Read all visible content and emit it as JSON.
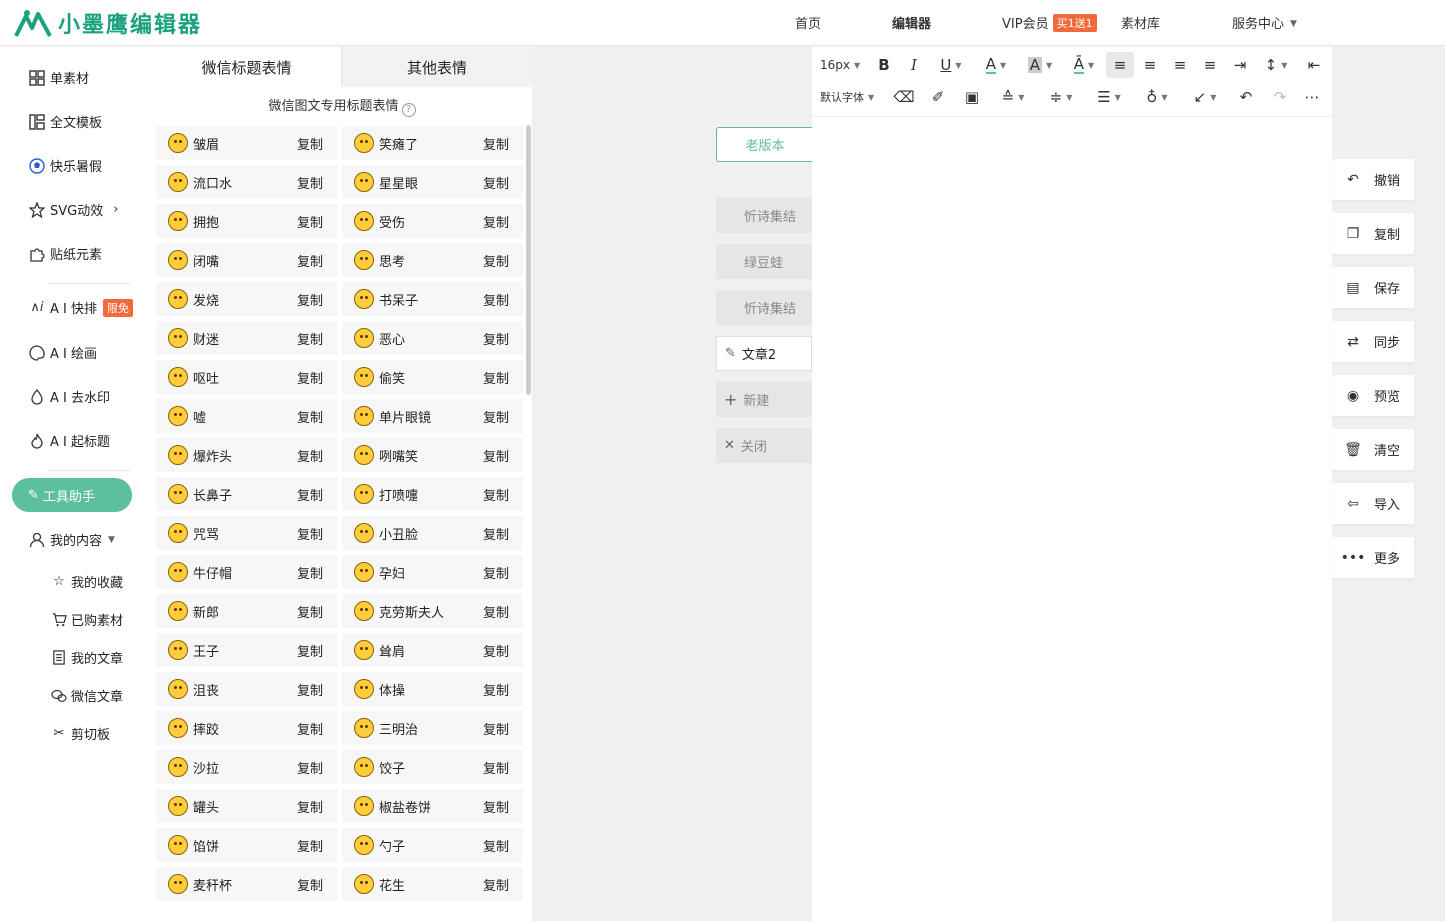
{
  "header": {
    "logo_text": "小墨鹰编辑器",
    "nav": [
      {
        "label": "首页"
      },
      {
        "label": "编辑器"
      },
      {
        "label": "VIP会员",
        "badge": "买1送1"
      },
      {
        "label": "素材库"
      },
      {
        "label": "服务中心"
      }
    ]
  },
  "sidebar": {
    "items": [
      {
        "label": "单素材",
        "icon": "grid-icon"
      },
      {
        "label": "全文模板",
        "icon": "template-icon"
      },
      {
        "label": "快乐暑假",
        "icon": "ball-icon"
      },
      {
        "label": "SVG动效",
        "icon": "star-icon"
      },
      {
        "label": "贴纸元素",
        "icon": "puzzle-icon"
      },
      {
        "label": "A I 快排",
        "icon": "ai-icon",
        "badge": "限免"
      },
      {
        "label": "A I 绘画",
        "icon": "palette-icon"
      },
      {
        "label": "A I 去水印",
        "icon": "drop-icon"
      },
      {
        "label": "A I 起标题",
        "icon": "flame-icon"
      }
    ],
    "tool_button": "工具助手",
    "my_content": "我的内容",
    "sub_items": [
      {
        "label": "我的收藏"
      },
      {
        "label": "已购素材"
      },
      {
        "label": "我的文章"
      },
      {
        "label": "微信文章"
      },
      {
        "label": "剪切板"
      }
    ]
  },
  "emoji_panel": {
    "tabs": [
      "微信标题表情",
      "其他表情"
    ],
    "subtitle": "微信图文专用标题表情",
    "help_symbol": "?",
    "copy_label": "复制",
    "emojis": [
      [
        "皱眉",
        "笑瘫了"
      ],
      [
        "流口水",
        "星星眼"
      ],
      [
        "拥抱",
        "受伤"
      ],
      [
        "闭嘴",
        "思考"
      ],
      [
        "发烧",
        "书呆子"
      ],
      [
        "财迷",
        "恶心"
      ],
      [
        "呕吐",
        "偷笑"
      ],
      [
        "嘘",
        "单片眼镜"
      ],
      [
        "爆炸头",
        "咧嘴笑"
      ],
      [
        "长鼻子",
        "打喷嚏"
      ],
      [
        "咒骂",
        "小丑脸"
      ],
      [
        "牛仔帽",
        "孕妇"
      ],
      [
        "新郎",
        "克劳斯夫人"
      ],
      [
        "王子",
        "耸肩"
      ],
      [
        "沮丧",
        "体操"
      ],
      [
        "摔跤",
        "三明治"
      ],
      [
        "沙拉",
        "饺子"
      ],
      [
        "罐头",
        "椒盐卷饼"
      ],
      [
        "馅饼",
        "勺子"
      ],
      [
        "麦秆杯",
        "花生"
      ]
    ]
  },
  "doc_tabs": {
    "old_version": "老版本",
    "items": [
      "忻诗集结",
      "绿豆蛙",
      "忻诗集结"
    ],
    "active": "文章2",
    "new": "新建",
    "close": "关闭"
  },
  "editor": {
    "font_size": "16px",
    "font_family": "默认字体"
  },
  "actions": [
    {
      "label": "撤销",
      "icon": "undo-icon"
    },
    {
      "label": "复制",
      "icon": "copy-icon"
    },
    {
      "label": "保存",
      "icon": "save-icon"
    },
    {
      "label": "同步",
      "icon": "sync-icon"
    },
    {
      "label": "预览",
      "icon": "eye-icon"
    },
    {
      "label": "清空",
      "icon": "trash-icon"
    },
    {
      "label": "导入",
      "icon": "import-icon"
    },
    {
      "label": "更多",
      "icon": "more-icon"
    }
  ],
  "colors": {
    "brand": "#1aa27e",
    "accent": "#5cbf9d",
    "badge": "#f36a3a"
  }
}
